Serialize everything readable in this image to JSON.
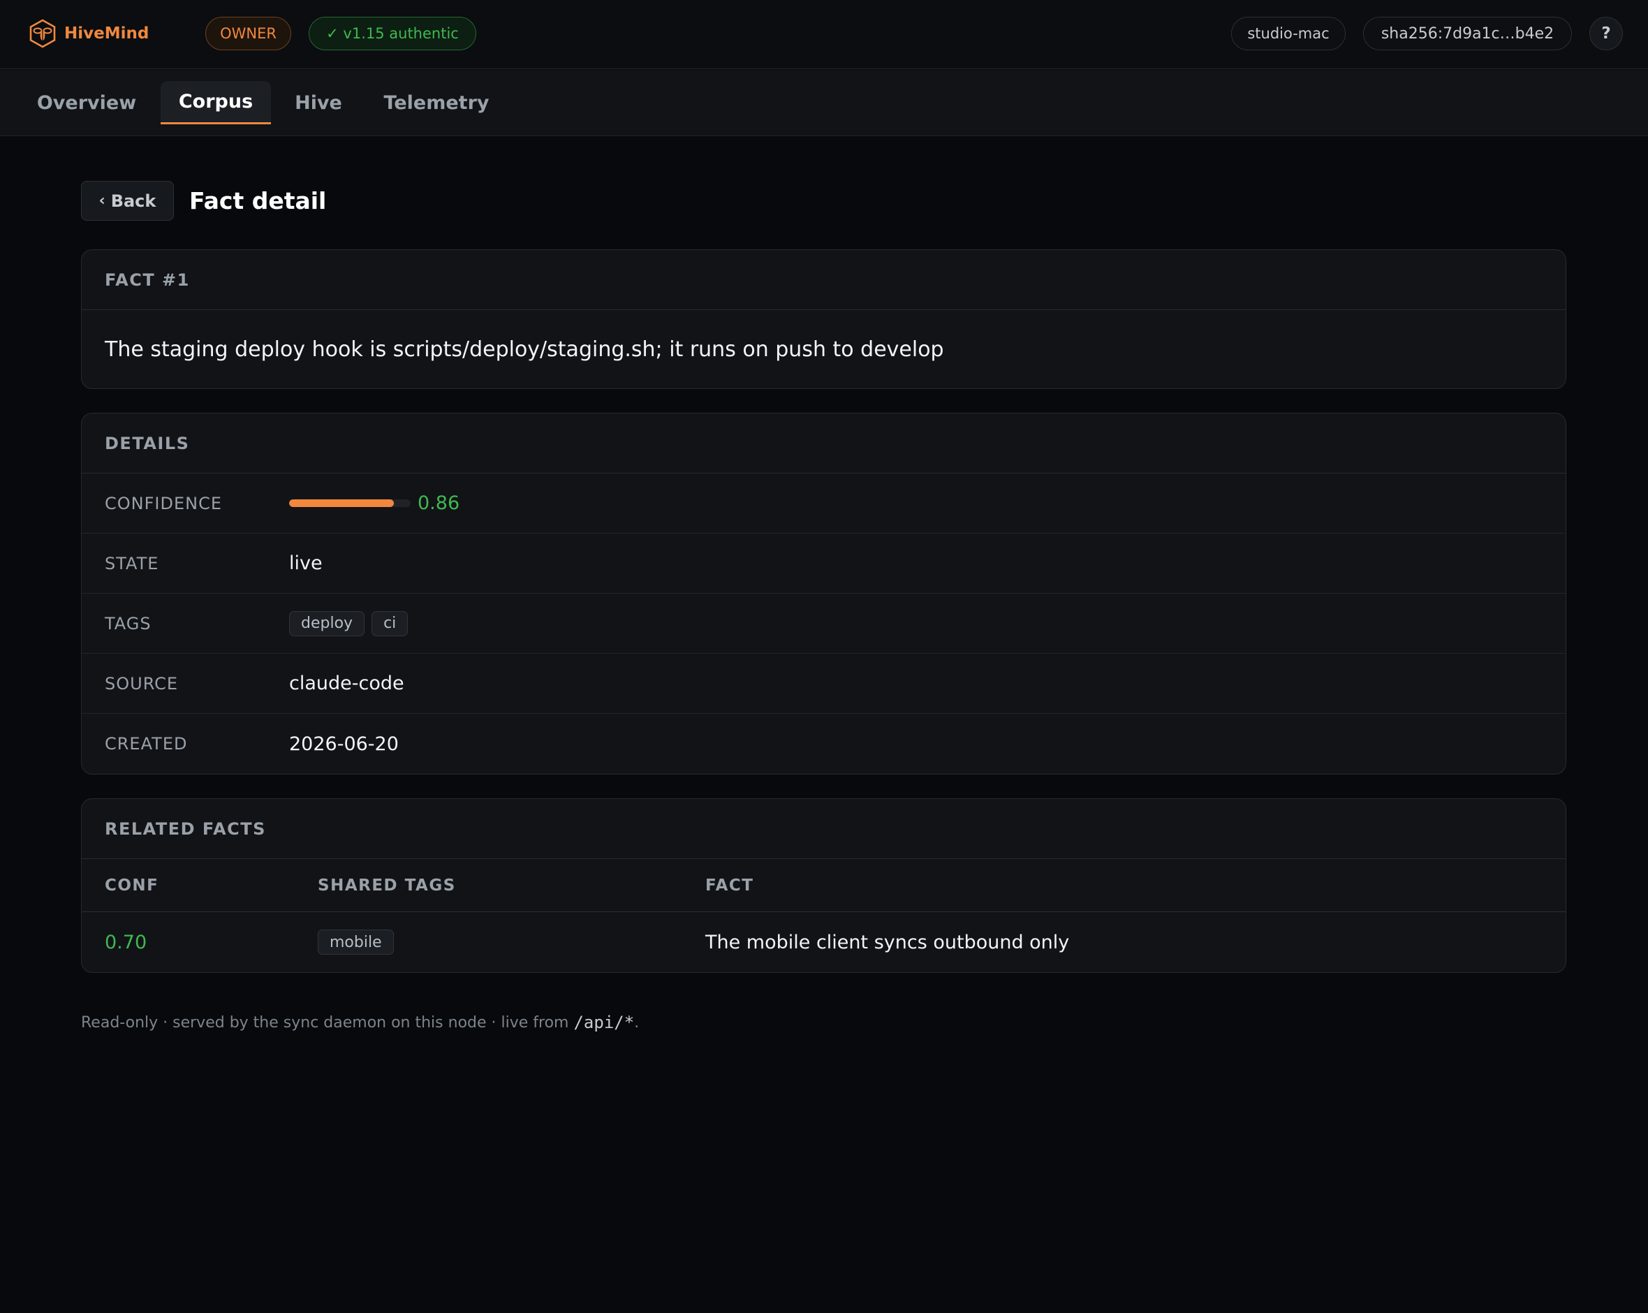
{
  "app": {
    "name": "HiveMind",
    "role_badge": "OWNER",
    "auth_badge": "✓ v1.15 authentic",
    "host": "studio-mac",
    "hash": "sha256:7d9a1c…b4e2",
    "help_label": "?"
  },
  "tabs": [
    {
      "label": "Overview"
    },
    {
      "label": "Corpus",
      "active": true
    },
    {
      "label": "Hive"
    },
    {
      "label": "Telemetry"
    }
  ],
  "page": {
    "back_label": "Back",
    "title": "Fact detail"
  },
  "fact": {
    "heading": "FACT #1",
    "text": "The staging deploy hook is scripts/deploy/staging.sh; it runs on push to develop"
  },
  "details": {
    "heading": "DETAILS",
    "confidence_label": "CONFIDENCE",
    "confidence": "0.86",
    "confidence_fraction": 0.86,
    "state_label": "STATE",
    "state": "live",
    "tags_label": "TAGS",
    "tags": [
      "deploy",
      "ci"
    ],
    "source_label": "SOURCE",
    "source": "claude-code",
    "created_label": "CREATED",
    "created": "2026-06-20"
  },
  "related": {
    "heading": "RELATED FACTS",
    "columns": [
      "CONF",
      "SHARED TAGS",
      "FACT"
    ],
    "rows": [
      {
        "conf": "0.70",
        "shared_tags": [
          "mobile"
        ],
        "fact": "The mobile client syncs outbound only"
      }
    ]
  },
  "footer": {
    "text": "Read-only · served by the sync daemon on this node · live from ",
    "code": "/api/*",
    "suffix": "."
  },
  "colors": {
    "accent": "#f0883e",
    "success": "#3fb950",
    "background": "#07090c"
  },
  "icons": {
    "logo": "bee-hexagon-icon",
    "back": "chevron-left-icon"
  }
}
